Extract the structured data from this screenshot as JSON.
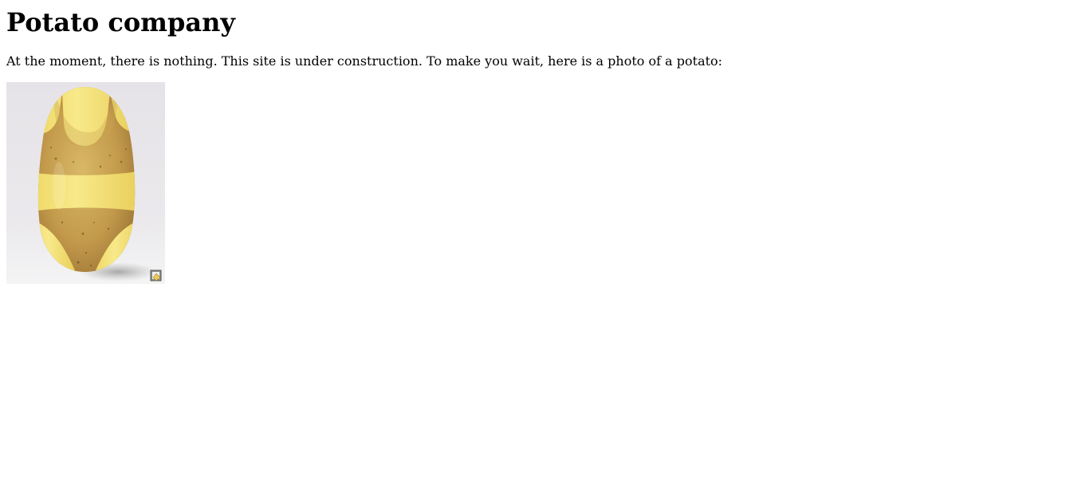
{
  "page": {
    "title": "Potato company",
    "intro": "At the moment, there is nothing. This site is under construction. To make you wait, here is a photo of a potato:"
  },
  "photo": {
    "subject": "potato-in-bikini",
    "icon": "image-badge-icon"
  },
  "colors": {
    "text": "#000000",
    "background": "#ffffff",
    "potato_skin": "#c9a85a",
    "potato_flesh": "#f3e07a",
    "photo_bg": "#e4e2e6"
  }
}
